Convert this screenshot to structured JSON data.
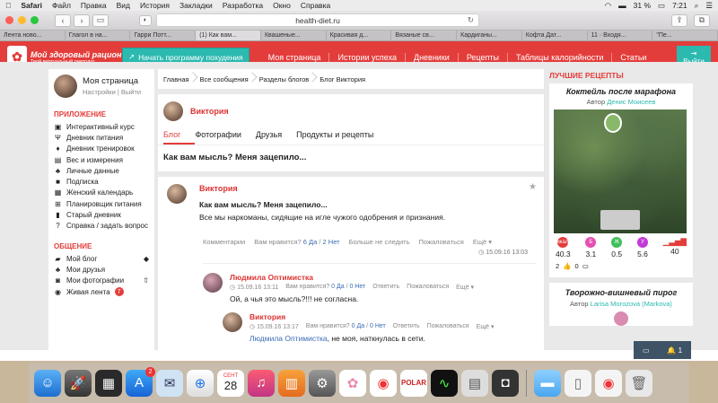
{
  "menubar": {
    "apple": "",
    "app": "Safari",
    "items": [
      "Файл",
      "Правка",
      "Вид",
      "История",
      "Закладки",
      "Разработка",
      "Окно",
      "Справка"
    ],
    "battery": "31 %",
    "time": "7:21"
  },
  "browser": {
    "url": "health-diet.ru",
    "tabs": [
      "Лента ново...",
      "Глагол в на...",
      "Гарри Потт...",
      "(1) Как вам...",
      "Квашеные...",
      "Красивая д...",
      "Вязаные св...",
      "Кардиганы...",
      "Кофта Дат...",
      "11 · Входя...",
      "\"Пе..."
    ],
    "active_tab": 3
  },
  "header": {
    "logo_title": "Мой здоровый рацион",
    "logo_subtitle": "Твой виртуальный диетолог",
    "start_button": "Начать программу похудения",
    "nav": [
      "Моя страница",
      "Истории успеха",
      "Дневники",
      "Рецепты",
      "Таблицы калорийности",
      "Статьи"
    ],
    "logout": "Выйти"
  },
  "sidebar": {
    "profile_name": "Моя страница",
    "settings": "Настройки",
    "logout": "Выйти",
    "app_title": "ПРИЛОЖЕНИЕ",
    "app_items": [
      "Интерактивный курс",
      "Дневник питания",
      "Дневник тренировок",
      "Вес и измерения",
      "Личные данные",
      "Подписка",
      "Женский календарь",
      "Планировщик питания",
      "Старый дневник",
      "Справка / задать вопрос"
    ],
    "social_title": "ОБЩЕНИЕ",
    "social_items": [
      "Мой блог",
      "Мои друзья",
      "Мои фотографии",
      "Живая лента"
    ],
    "live_badge": "7"
  },
  "breadcrumb": [
    "Главная",
    "Все сообщения",
    "Разделы блогов",
    "Блог Виктория"
  ],
  "user_card": {
    "name": "Виктория",
    "tabs": [
      "Блог",
      "Фотографии",
      "Друзья",
      "Продукты и рецепты"
    ],
    "title": "Как вам мысль? Меня зацепило..."
  },
  "post": {
    "author": "Виктория",
    "title": "Как вам мысль? Меня зацепило...",
    "text": "Все мы наркоманы, сидящие на игле чужого одобрения и признания.",
    "comments_label": "Комментарии",
    "like_label": "Вам нравится?",
    "yes": "6 Да",
    "no": "2 Нет",
    "unfollow": "Больше не следить",
    "complain": "Пожаловаться",
    "more": "Ещё",
    "date": "15.09.16 13:03"
  },
  "comments": [
    {
      "author": "Людмила Оптимистка",
      "date": "15.09.16 13:11",
      "like_label": "Вам нравится?",
      "yes": "0 Да",
      "no": "0 Нет",
      "reply": "Ответить",
      "complain": "Пожаловаться",
      "more": "Ещё",
      "text": "Ой, а чья это мысль?!!! не согласна."
    },
    {
      "author": "Виктория",
      "date": "15.09.16 13:17",
      "like_label": "Вам нравится?",
      "yes": "0 Да",
      "no": "0 Нет",
      "reply": "Ответить",
      "complain": "Пожаловаться",
      "more": "Ещё",
      "mention": "Людмила Оптимистка",
      "text": ", не моя, наткнулась в сети."
    }
  ],
  "right": {
    "heading": "ЛУЧШИЕ РЕЦЕПТЫ",
    "recipe1": {
      "title": "Коктейль после марафона",
      "author_label": "Автор",
      "author": "Денис Моисеев",
      "nutrients": [
        {
          "label": "ккал",
          "value": "40.3",
          "color": "#e33d3b"
        },
        {
          "label": "Б",
          "value": "3.1",
          "color": "#e64fb0"
        },
        {
          "label": "Ж",
          "value": "0.5",
          "color": "#3fbf5a"
        },
        {
          "label": "У",
          "value": "5.6",
          "color": "#c43ad8"
        },
        {
          "label": "",
          "value": "40",
          "color": "#e33d3b"
        }
      ],
      "likes": "2",
      "comments": "0"
    },
    "recipe2": {
      "title": "Творожно-вишневый пирог",
      "author_label": "Автор",
      "author": "Larisa Morozova (Markova)"
    }
  },
  "chat": {
    "count": "1"
  },
  "dock": {
    "calendar_month": "СЕНТ",
    "calendar_day": "28",
    "appstore_badge": "2"
  }
}
